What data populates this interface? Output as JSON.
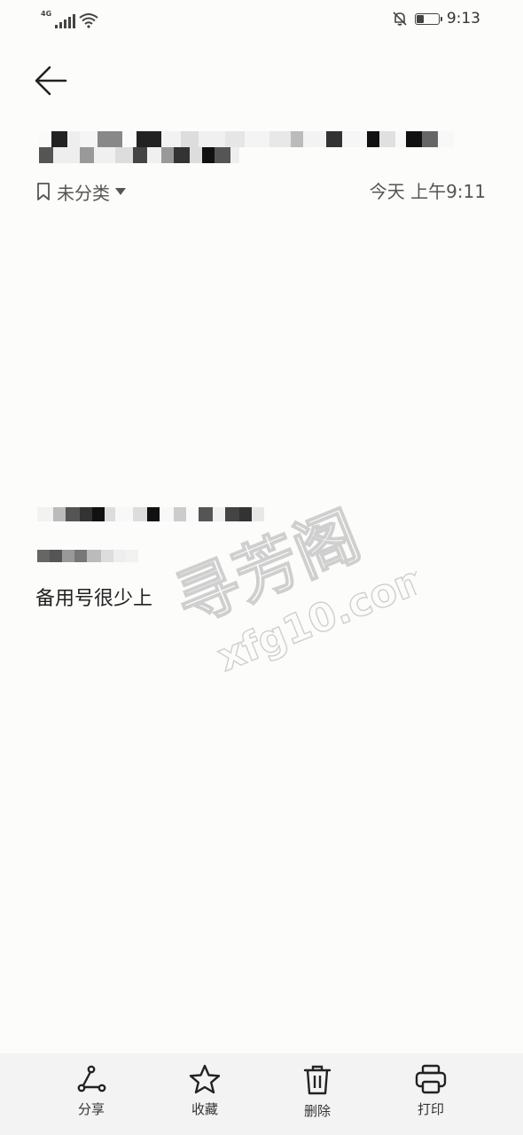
{
  "status_bar": {
    "network": "4G",
    "time": "9:13",
    "battery_level": 0.35
  },
  "header": {
    "category": "未分类",
    "date": "今天 上午9:11"
  },
  "note": {
    "body": "备用号很少上"
  },
  "watermark": {
    "line1": "寻芳阁",
    "line2": "xfg10.com"
  },
  "toolbar": {
    "share": "分享",
    "favorite": "收藏",
    "delete": "删除",
    "print": "打印"
  }
}
